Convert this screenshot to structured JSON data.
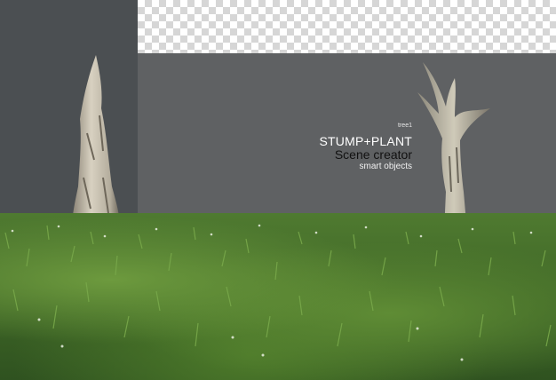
{
  "scene": {
    "tag": "tree1",
    "title": "STUMP+PLANT",
    "subtitle": "Scene creator",
    "caption": "smart objects"
  },
  "colors": {
    "background_dark": "#4b4f52",
    "background_mid": "#5f6163",
    "grass": "#4f7a30",
    "bark": "#c9c2b2"
  }
}
